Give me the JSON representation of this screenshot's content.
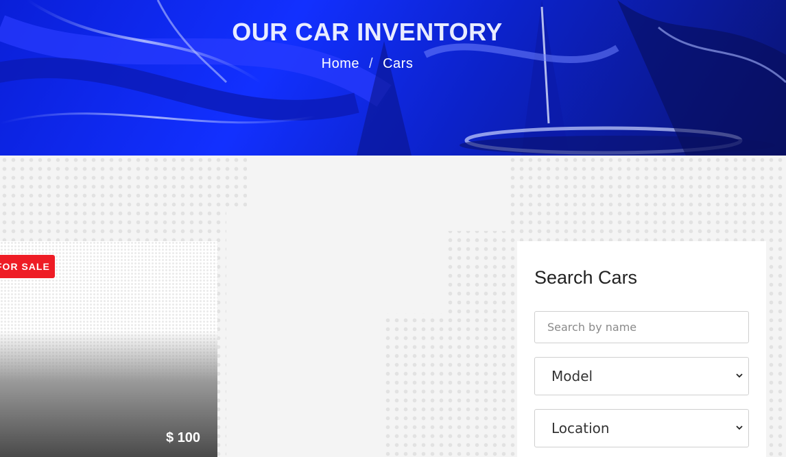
{
  "hero": {
    "title": "OUR CAR INVENTORY",
    "breadcrumb": [
      {
        "label": "Home"
      },
      {
        "label": "Cars"
      }
    ],
    "separator": "/"
  },
  "car_card": {
    "badge": "FOR SALE",
    "price": "$ 100"
  },
  "search_panel": {
    "title": "Search Cars",
    "name_input": {
      "placeholder": "Search by name",
      "value": ""
    },
    "model_select": {
      "selected": "Model"
    },
    "location_select": {
      "selected": "Location"
    }
  },
  "colors": {
    "hero_blue": "#1230ff",
    "badge_red": "#ee1c25",
    "page_bg": "#f4f4f4"
  },
  "icons": [
    "chevron-down-icon"
  ]
}
